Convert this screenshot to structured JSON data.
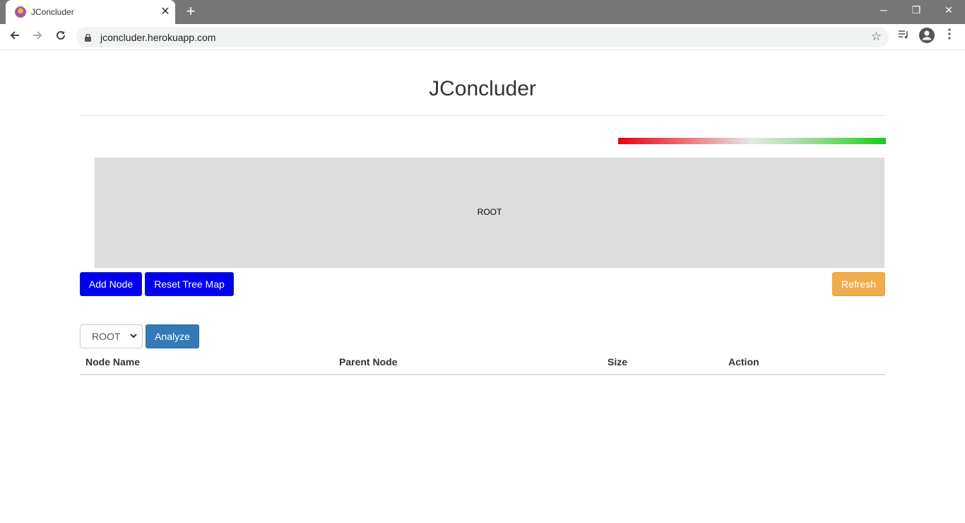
{
  "browser": {
    "tab_title": "JConcluder",
    "new_tab": "+",
    "tab_close": "✕",
    "url": "jconcluder.herokuapp.com",
    "window": {
      "minimize": "─",
      "restore": "❐",
      "close": "✕"
    }
  },
  "header": {
    "title": "JConcluder"
  },
  "treemap": {
    "root_label": "ROOT",
    "gradient_colors": [
      "#e8000c",
      "#e8e8e8",
      "#18cc18"
    ],
    "background": "#dddddd"
  },
  "actions": {
    "add_node": "Add Node",
    "reset_tree_map": "Reset Tree Map",
    "refresh": "Refresh"
  },
  "analyze": {
    "selected_node": "ROOT",
    "options": [
      "ROOT"
    ],
    "button": "Analyze"
  },
  "table": {
    "columns": [
      "Node Name",
      "Parent Node",
      "Size",
      "Action"
    ],
    "rows": []
  },
  "colors": {
    "primary_button": "#0000ee",
    "analyze_button": "#337ab7",
    "refresh_button": "#f0ad4e"
  }
}
